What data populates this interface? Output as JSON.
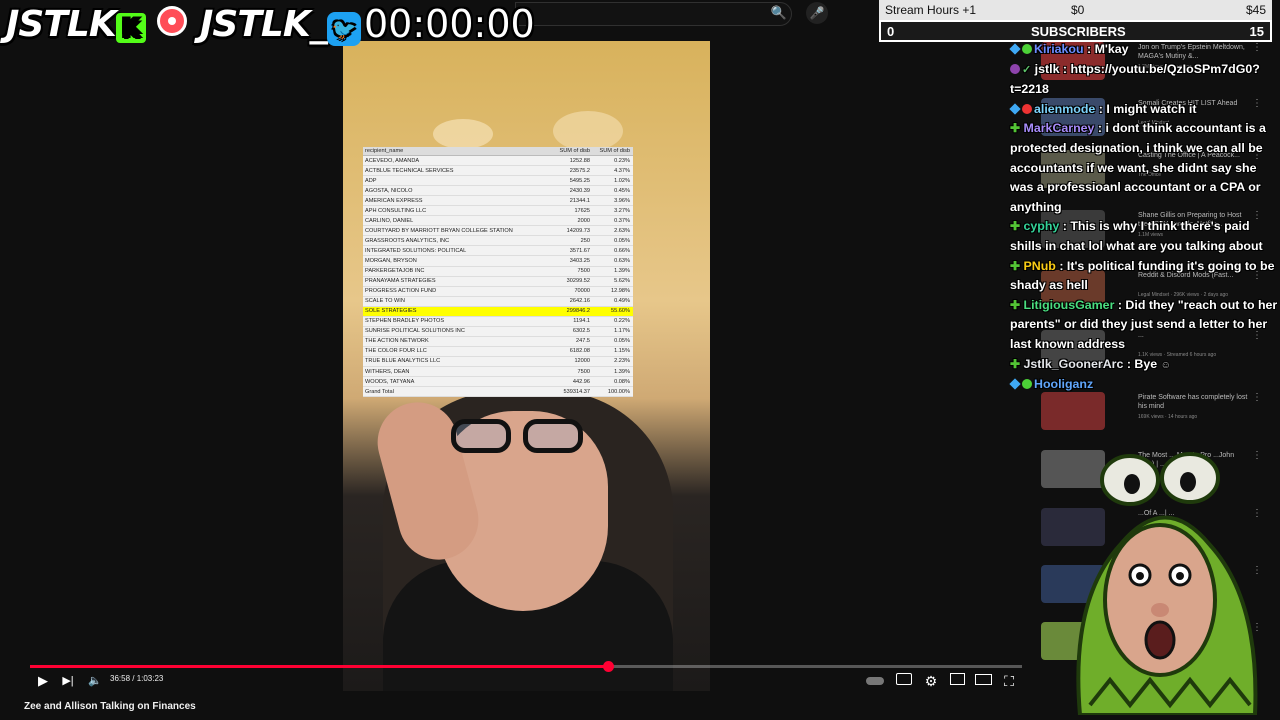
{
  "overlay": {
    "logo1": "JSTLK",
    "logo1_badge": "K",
    "logo2": "JSTLK_",
    "timer": "00:00:00"
  },
  "video": {
    "title": "Zee and Allison Talking on Finances",
    "time": "36:58 / 1:03:23",
    "progress": 0.583
  },
  "spreadsheet": {
    "headers": [
      "recipient_name",
      "SUM of disb",
      "SUM of disb"
    ],
    "rows": [
      [
        "ACEVEDO, AMANDA",
        "1252.88",
        "0.23%"
      ],
      [
        "ACTBLUE TECHNICAL SERVICES",
        "23575.2",
        "4.37%"
      ],
      [
        "ADP",
        "5495.25",
        "1.02%"
      ],
      [
        "AGOSTA, NICOLO",
        "2430.39",
        "0.45%"
      ],
      [
        "AMERICAN EXPRESS",
        "21344.1",
        "3.96%"
      ],
      [
        "APH CONSULTING LLC",
        "17625",
        "3.27%"
      ],
      [
        "CARLINO, DANIEL",
        "2000",
        "0.37%"
      ],
      [
        "COURTYARD BY MARRIOTT BRYAN COLLEGE STATION",
        "14209.73",
        "2.63%"
      ],
      [
        "GRASSROOTS ANALYTICS, INC",
        "250",
        "0.05%"
      ],
      [
        "INTEGRATED SOLUTIONS: POLITICAL",
        "3571.67",
        "0.66%"
      ],
      [
        "MORGAN, BRYSON",
        "3403.25",
        "0.63%"
      ],
      [
        "PARKERGETAJOB INC",
        "7500",
        "1.39%"
      ],
      [
        "PRANAYAMA STRATEGIES",
        "30299.52",
        "5.62%"
      ],
      [
        "PROGRESS ACTION FUND",
        "70000",
        "12.98%"
      ],
      [
        "SCALE TO WIN",
        "2642.16",
        "0.49%"
      ],
      [
        "SOLE STRATEGIES",
        "299846.2",
        "55.60%"
      ],
      [
        "STEPHEN BRADLEY PHOTOS",
        "1194.1",
        "0.22%"
      ],
      [
        "SUNRISE POLITICAL SOLUTIONS INC",
        "6302.5",
        "1.17%"
      ],
      [
        "THE ACTION NETWORK",
        "247.5",
        "0.05%"
      ],
      [
        "THE COLOR FOUR LLC",
        "6182.08",
        "1.15%"
      ],
      [
        "TRUE BLUE ANALYTICS LLC",
        "12000",
        "2.23%"
      ],
      [
        "WITHERS, DEAN",
        "7500",
        "1.39%"
      ],
      [
        "WOODS, TATYANA",
        "442.96",
        "0.08%"
      ],
      [
        "Grand Total",
        "539314.37",
        "100.00%"
      ]
    ],
    "highlight_row": 15
  },
  "stream_hours": {
    "label": "Stream Hours +1",
    "raised": "$0",
    "goal": "$45",
    "subs_count": "0",
    "subs_label": "SUBSCRIBERS",
    "subs_goal": "15"
  },
  "recommendations": [
    {
      "title": "Jon on Trump's Epstein Meltdown, MAGA's Mutiny &...",
      "meta": "1.2M views · 3 days ago"
    },
    {
      "title": "Somali Creates HIT LIST Ahead",
      "meta": "Legal Mindset"
    },
    {
      "title": "Casting The Office | A Peacock...",
      "meta": "The Office"
    },
    {
      "title": "Shane Gillis on Preparing to Host the ESPY Awards, Netflix...",
      "meta": "1.1M views"
    },
    {
      "title": "Reddit & Discord Mods (Fast...",
      "meta": "Legal Mindset · 296K views · 2 days ago"
    },
    {
      "title": "...",
      "meta": "1.1K views · Streamed 6 hours ago"
    },
    {
      "title": "Pirate Software has completely lost his mind",
      "meta": "169K views · 14 hours ago"
    },
    {
      "title": "The Most ... Man In Pro ...John Daly) | ...",
      "meta": ""
    },
    {
      "title": "...Of A ...| ...",
      "meta": ""
    },
    {
      "title": "...fired...",
      "meta": ""
    },
    {
      "title": "...palworld",
      "meta": ""
    }
  ],
  "chat": [
    {
      "user": "SUBSCRIBERS",
      "text": "",
      "color": "#ffffff"
    },
    {
      "user": "Kiriakou",
      "text": "M'kay",
      "color": "#6c8cff"
    },
    {
      "user": "jstlk",
      "text": "https://youtu.be/QzIoSPm7dG0?t=2218",
      "color": "#ffffff"
    },
    {
      "user": "alienmode",
      "text": "I might watch it",
      "color": "#7dd3fc"
    },
    {
      "user": "MarkCarney",
      "text": "i dont think accountant is a protected designation, i think we can all be accountants if we want, she didnt say she was a professioanl accountant or a CPA or anything",
      "color": "#a78bfa"
    },
    {
      "user": "cyphy",
      "text": "This is why I think there's paid shills in chat lol what are you talking about",
      "color": "#34d399"
    },
    {
      "user": "PNub",
      "text": "It's political funding it's going to be shady as hell",
      "color": "#facc15"
    },
    {
      "user": "LitigiousGamer",
      "text": "Did they \"reach out to her parents\" or did they just send a letter to her last known address",
      "color": "#4ade80"
    },
    {
      "user": "Jstlk_GoonerArc",
      "text": "Bye",
      "color": "#e5e7eb"
    },
    {
      "user": "Hooliganz",
      "text": "",
      "color": "#60a5fa"
    }
  ],
  "icons": {
    "play": "▶",
    "next": "▶|",
    "volume": "🔈",
    "settings": "⚙",
    "fullscreen": "⛶"
  },
  "colors": {
    "accent": "#ff0033",
    "highlight": "#ffff00"
  }
}
